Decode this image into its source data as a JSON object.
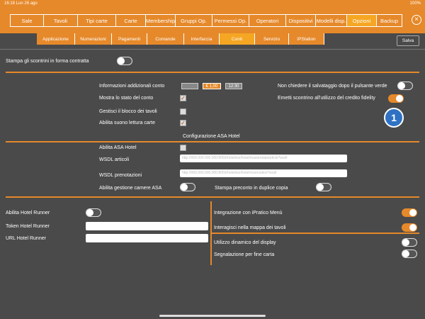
{
  "status": {
    "time_date": "16:18  Lun 26 ago",
    "battery": "100%"
  },
  "top_tabs": [
    "Sale",
    "Tavoli",
    "Tipi carte",
    "Carte",
    "Membership",
    "Gruppi Op.",
    "Permessi Op.",
    "Operatori",
    "Dispositivi",
    "Modelli disp.",
    "Opzioni",
    "Backup"
  ],
  "top_active": "Opzioni",
  "sub_tabs": [
    "Applicazione",
    "Numerazioni",
    "Pagamenti",
    "Comande",
    "Interfaccia",
    "Conti",
    "Servizio",
    "IPStation"
  ],
  "sub_active": "Conti",
  "save_label": "Salva",
  "settings": {
    "stampa_contratta": "Stampa gli scontrini in forma contratta",
    "info_aggiuntive": "Informazioni addizionali conto",
    "info_pills": [
      "",
      "€ 1,00",
      "12:30"
    ],
    "mostra_stato": "Mostra lo stato del conto",
    "gestisci_blocco": "Gestisci il blocco dei tavoli",
    "abilita_suono": "Abilita suono lettura carte",
    "non_chiedere": "Non chiedere il salvataggio dopo il pulsante verde",
    "emetti_scontrino": "Emetti scontrino all'utilizzo del credito fidelity",
    "badge_number": "1"
  },
  "asa": {
    "section_title": "Configurazione ASA Hotel",
    "abilita": "Abilita ASA Hotel",
    "wsdl_articoli": "WSDL articoli",
    "wsdl_articoli_value": "http://000.000.000.000:8050/hotel/ws/hotel/masterdata/article?wsdl",
    "wsdl_prenotazioni": "WSDL prenotazioni",
    "wsdl_prenotazioni_value": "http://000.000.000.000:8050/hotel/ws/hotel/reservation?wsdl",
    "gestione_camere": "Abilita gestione camere ASA",
    "preconto_duplice": "Stampa preconto in duplice copia"
  },
  "runner": {
    "abilita": "Abilita Hotel Runner",
    "token": "Token Hotel Runner",
    "url": "URL Hotel Runner"
  },
  "right_options": {
    "ipratico_menu": "Integrazione con iPratico Menù",
    "mappa_tavoli": "Interagisci nella mappa dei tavoli",
    "display_dinamico": "Utilizzo dinamico del display",
    "fine_carta": "Segnalazione per fine carta"
  },
  "colors": {
    "accent": "#e6892a",
    "background": "#4a4a4a",
    "badge": "#2f72c4"
  }
}
